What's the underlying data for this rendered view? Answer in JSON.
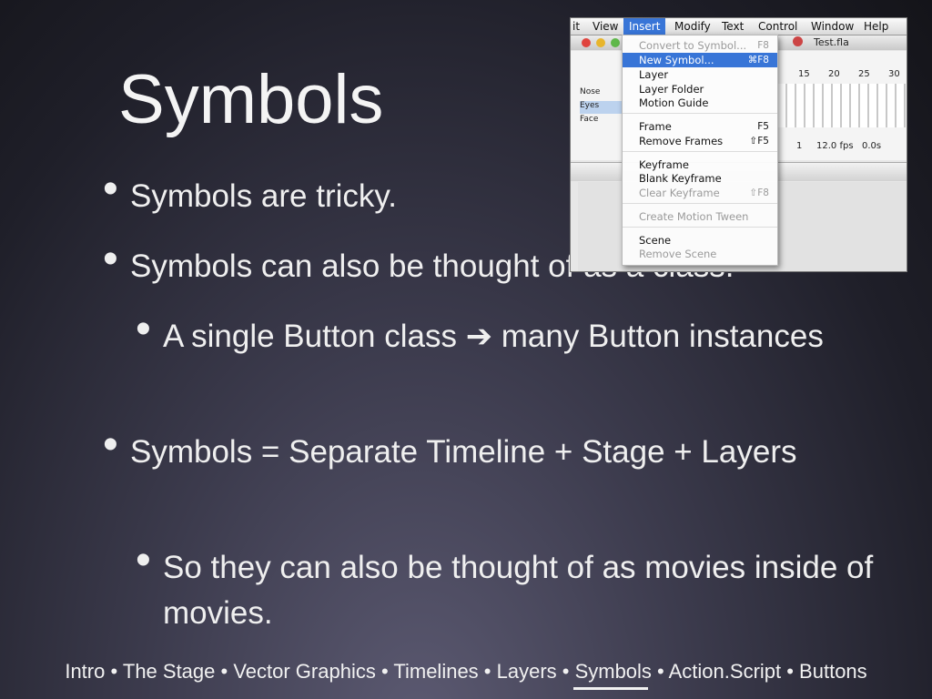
{
  "slide": {
    "title": "Symbols",
    "bullets": [
      "Symbols are tricky.",
      "Symbols can also be thought of as a class.",
      "A single Button class ➔ many Button instances",
      "Symbols = Separate Timeline + Stage + Layers",
      "So they can also be thought of as movies inside of movies."
    ],
    "bullet_glyph": "•",
    "footer": "Intro • The Stage • Vector Graphics • Timelines • Layers • Symbols • Action.Script • Buttons"
  },
  "screenshot": {
    "menubar": [
      "it",
      "View",
      "Insert",
      "Modify",
      "Text",
      "Control",
      "Window",
      "Help"
    ],
    "active_menu": "Insert",
    "document_title": "Test.fla",
    "ruler_ticks": [
      "15",
      "20",
      "25",
      "30"
    ],
    "layers": [
      "Nose",
      "Eyes",
      "Face"
    ],
    "status": {
      "frame": "1",
      "fps": "12.0 fps",
      "time": "0.0s"
    },
    "insert_menu": [
      {
        "label": "Convert to Symbol...",
        "shortcut": "F8",
        "state": "disabled"
      },
      {
        "label": "New Symbol...",
        "shortcut": "⌘F8",
        "state": "highlighted"
      },
      {
        "label": "Layer",
        "shortcut": "",
        "state": "enabled"
      },
      {
        "label": "Layer Folder",
        "shortcut": "",
        "state": "enabled"
      },
      {
        "label": "Motion Guide",
        "shortcut": "",
        "state": "enabled"
      },
      {
        "label": "Frame",
        "shortcut": "F5",
        "state": "enabled"
      },
      {
        "label": "Remove Frames",
        "shortcut": "⇧F5",
        "state": "enabled"
      },
      {
        "label": "Keyframe",
        "shortcut": "",
        "state": "enabled"
      },
      {
        "label": "Blank Keyframe",
        "shortcut": "",
        "state": "enabled"
      },
      {
        "label": "Clear Keyframe",
        "shortcut": "⇧F8",
        "state": "disabled"
      },
      {
        "label": "Create Motion Tween",
        "shortcut": "",
        "state": "disabled"
      },
      {
        "label": "Scene",
        "shortcut": "",
        "state": "enabled"
      },
      {
        "label": "Remove Scene",
        "shortcut": "",
        "state": "disabled"
      }
    ],
    "colors": {
      "highlight": "#3875d7",
      "close": "#e0443e",
      "minimize": "#e8b52c",
      "zoom": "#5fb84a"
    }
  }
}
